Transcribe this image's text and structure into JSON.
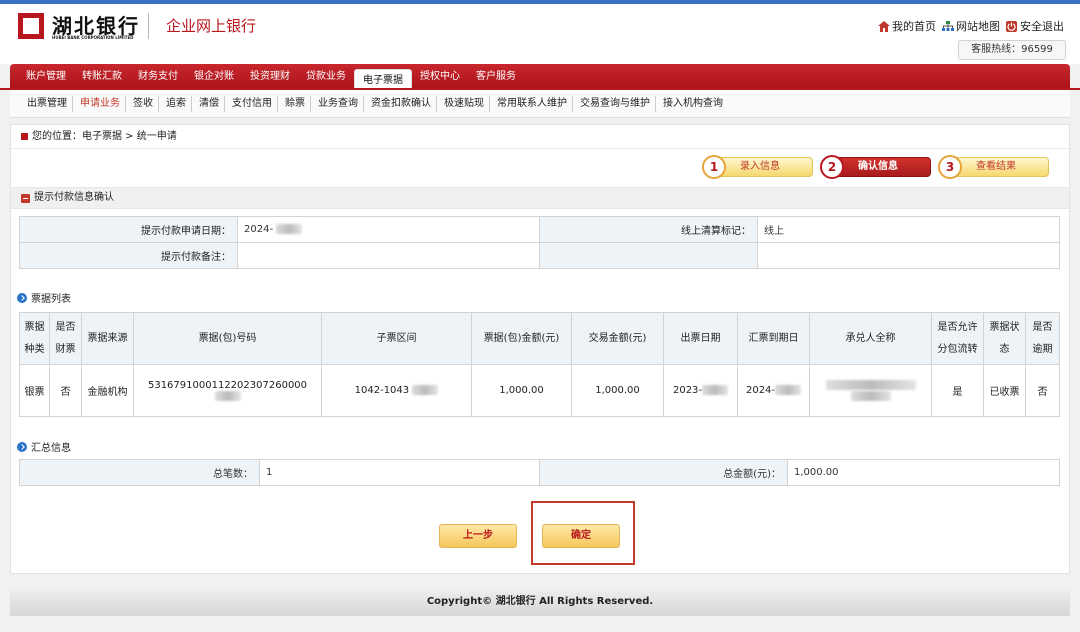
{
  "header": {
    "logo_text": "湖北银行",
    "logo_subtext": "HUBEI BANK CORPORATION LIMITED",
    "portal_title": "企业网上银行",
    "links": [
      {
        "label": "我的首页",
        "icon": "home-icon"
      },
      {
        "label": "网站地图",
        "icon": "sitemap-icon"
      },
      {
        "label": "安全退出",
        "icon": "exit-icon"
      }
    ],
    "hotline": "客服热线：96599"
  },
  "main_nav": [
    "账户管理",
    "转账汇款",
    "财务支付",
    "银企对账",
    "投资理财",
    "贷款业务",
    "电子票据",
    "授权中心",
    "客户服务"
  ],
  "main_nav_active": "电子票据",
  "sub_nav": [
    "出票管理",
    "申请业务",
    "签收",
    "追索",
    "清偿",
    "支付信用",
    "赊票",
    "业务查询",
    "资金扣款确认",
    "极速贴现",
    "常用联系人维护",
    "交易查询与维护",
    "接入机构查询"
  ],
  "sub_nav_active": "申请业务",
  "breadcrumb": "您的位置：电子票据 > 统一申请",
  "steps": [
    {
      "num": "1",
      "label": "录入信息"
    },
    {
      "num": "2",
      "label": "确认信息"
    },
    {
      "num": "3",
      "label": "查看结果"
    }
  ],
  "active_step": "2",
  "section_title": "提示付款信息确认",
  "form": {
    "apply_date_label": "提示付款申请日期：",
    "apply_date_value": "2024-",
    "clear_label": "线上清算标记：",
    "clear_value": "线上",
    "remark_label": "提示付款备注：",
    "remark_value": ""
  },
  "bill_list_title": "票据列表",
  "bill_table": {
    "headers": [
      "票据种类",
      "是否财票",
      "票据来源",
      "票据(包)号码",
      "子票区间",
      "票据(包)金额(元)",
      "交易金额(元)",
      "出票日期",
      "汇票到期日",
      "承兑人全称",
      "是否允许分包流转",
      "票据状态",
      "是否逾期"
    ],
    "rows": [
      [
        "银票",
        "否",
        "金融机构",
        "5316791000112202307260000",
        "1042-1043",
        "1,000.00",
        "1,000.00",
        "2023-",
        "2024-",
        "",
        "是",
        "已收票",
        "否"
      ]
    ]
  },
  "summary_title": "汇总信息",
  "summary": {
    "count_label": "总笔数：",
    "count_value": "1",
    "amount_label": "总金额(元)：",
    "amount_value": "1,000.00"
  },
  "buttons": {
    "prev": "上一步",
    "confirm": "确定"
  },
  "footer": "Copyright© 湖北银行 All Rights Reserved.",
  "colors": {
    "brand": "#b8171d",
    "button": "#f5c75b",
    "header_cell": "#eef3f8"
  }
}
